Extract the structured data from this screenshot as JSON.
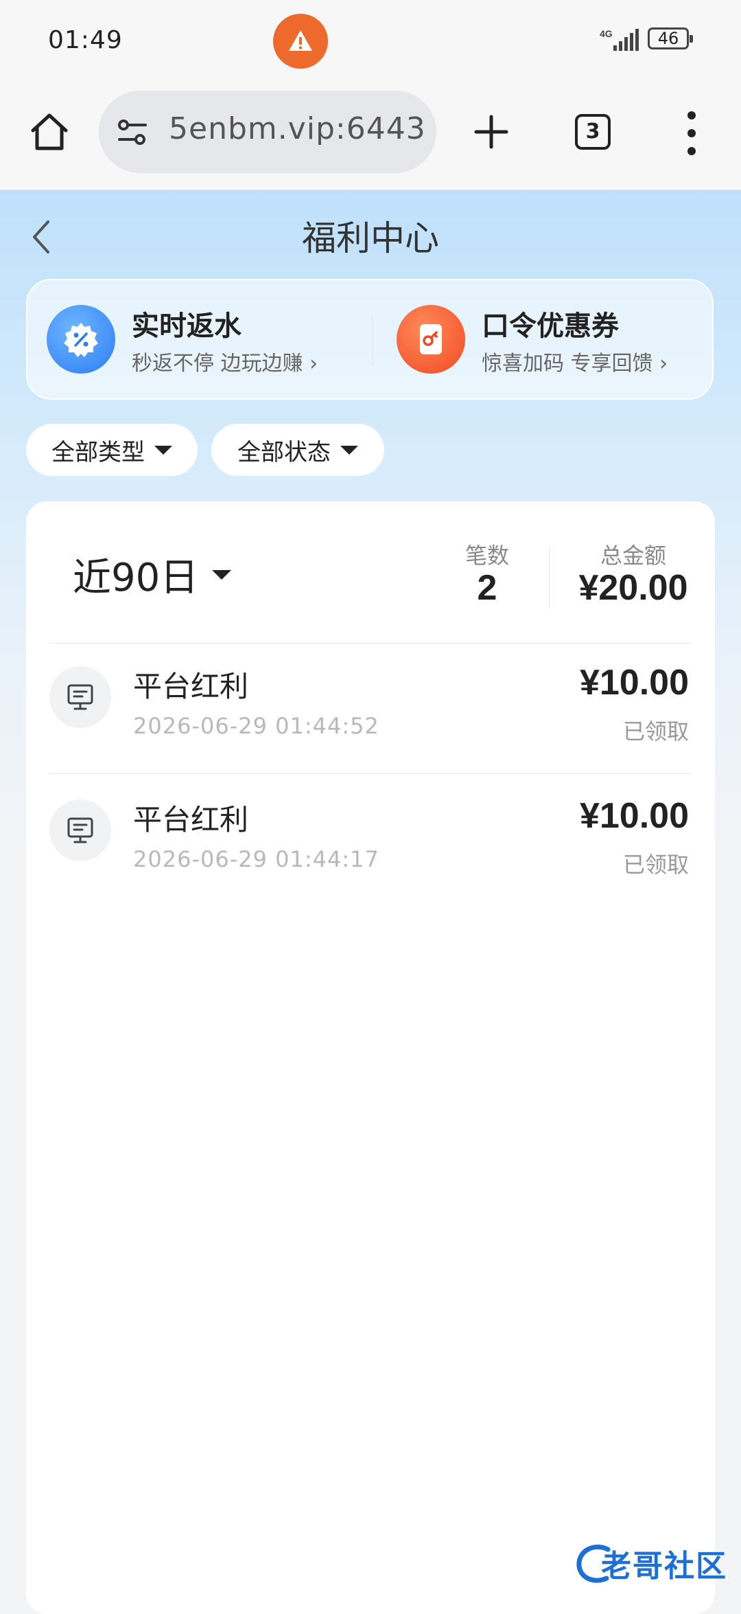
{
  "status_bar": {
    "time": "01:49",
    "network": "4G",
    "battery": "46"
  },
  "browser": {
    "url": "5enbm.vip:6443",
    "tab_count": "3"
  },
  "header": {
    "title": "福利中心"
  },
  "promos": [
    {
      "title": "实时返水",
      "subtitle": "秒返不停 边玩边赚 ›"
    },
    {
      "title": "口令优惠券",
      "subtitle": "惊喜加码 专享回馈 ›"
    }
  ],
  "filters": {
    "type_label": "全部类型",
    "status_label": "全部状态"
  },
  "summary": {
    "range_label": "近90日",
    "count_label": "笔数",
    "count_value": "2",
    "total_label": "总金额",
    "total_value": "¥20.00"
  },
  "records": [
    {
      "name": "平台红利",
      "datetime": "2026-06-29 01:44:52",
      "amount": "¥10.00",
      "status": "已领取"
    },
    {
      "name": "平台红利",
      "datetime": "2026-06-29 01:44:17",
      "amount": "¥10.00",
      "status": "已领取"
    }
  ],
  "watermark": {
    "text": "老哥社区"
  }
}
